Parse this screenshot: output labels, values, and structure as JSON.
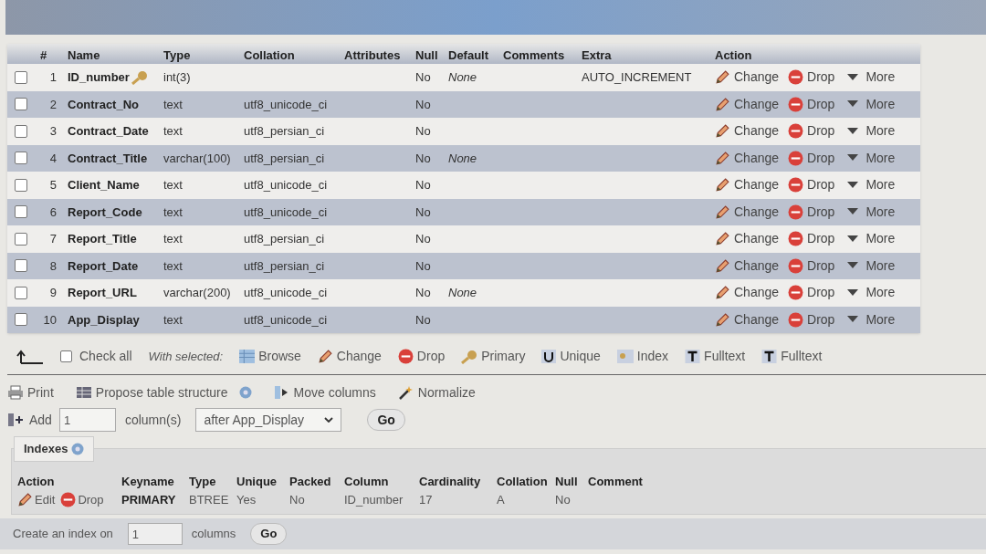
{
  "table": {
    "columns": [
      "#",
      "Name",
      "Type",
      "Collation",
      "Attributes",
      "Null",
      "Default",
      "Comments",
      "Extra",
      "Action"
    ],
    "rows": [
      {
        "number": "1",
        "name": "ID_number",
        "primary": true,
        "type": "int(3)",
        "collation": "",
        "null": "No",
        "default": "None",
        "extra": "AUTO_INCREMENT",
        "checked": false,
        "actions": [
          "Change",
          "Drop",
          "More"
        ]
      },
      {
        "number": "2",
        "name": "Contract_No",
        "primary": false,
        "type": "text",
        "collation": "utf8_unicode_ci",
        "null": "No",
        "default": "",
        "extra": "",
        "checked": false,
        "actions": [
          "Change",
          "Drop",
          "More"
        ]
      },
      {
        "number": "3",
        "name": "Contract_Date",
        "primary": false,
        "type": "text",
        "collation": "utf8_persian_ci",
        "null": "No",
        "default": "",
        "extra": "",
        "checked": false,
        "actions": [
          "Change",
          "Drop",
          "More"
        ]
      },
      {
        "number": "4",
        "name": "Contract_Title",
        "primary": false,
        "type": "varchar(100)",
        "collation": "utf8_persian_ci",
        "null": "No",
        "default": "None",
        "extra": "",
        "checked": false,
        "actions": [
          "Change",
          "Drop",
          "More"
        ]
      },
      {
        "number": "5",
        "name": "Client_Name",
        "primary": false,
        "type": "text",
        "collation": "utf8_unicode_ci",
        "null": "No",
        "default": "",
        "extra": "",
        "checked": false,
        "actions": [
          "Change",
          "Drop",
          "More"
        ]
      },
      {
        "number": "6",
        "name": "Report_Code",
        "primary": false,
        "type": "text",
        "collation": "utf8_unicode_ci",
        "null": "No",
        "default": "",
        "extra": "",
        "checked": false,
        "actions": [
          "Change",
          "Drop",
          "More"
        ]
      },
      {
        "number": "7",
        "name": "Report_Title",
        "primary": false,
        "type": "text",
        "collation": "utf8_persian_ci",
        "null": "No",
        "default": "",
        "extra": "",
        "checked": false,
        "actions": [
          "Change",
          "Drop",
          "More"
        ]
      },
      {
        "number": "8",
        "name": "Report_Date",
        "primary": false,
        "type": "text",
        "collation": "utf8_persian_ci",
        "null": "No",
        "default": "",
        "extra": "",
        "checked": false,
        "actions": [
          "Change",
          "Drop",
          "More"
        ]
      },
      {
        "number": "9",
        "name": "Report_URL",
        "primary": false,
        "type": "varchar(200)",
        "collation": "utf8_unicode_ci",
        "null": "No",
        "default": "None",
        "extra": "",
        "checked": false,
        "actions": [
          "Change",
          "Drop",
          "More"
        ]
      },
      {
        "number": "10",
        "name": "App_Display",
        "primary": false,
        "type": "text",
        "collation": "utf8_unicode_ci",
        "null": "No",
        "default": "",
        "extra": "",
        "checked": false,
        "actions": [
          "Change",
          "Drop",
          "More"
        ]
      }
    ]
  },
  "bulk": {
    "check_all": {
      "label": "Check all",
      "checked": false
    },
    "with_selected": "With selected:",
    "actions": [
      {
        "kind": "browse",
        "label": "Browse"
      },
      {
        "kind": "change",
        "label": "Change"
      },
      {
        "kind": "drop",
        "label": "Drop"
      },
      {
        "kind": "primary",
        "label": "Primary"
      },
      {
        "kind": "unique",
        "label": "Unique"
      },
      {
        "kind": "index",
        "label": "Index"
      },
      {
        "kind": "fulltext",
        "label": "Fulltext"
      },
      {
        "kind": "fulltext",
        "label": "Fulltext"
      }
    ]
  },
  "tools": [
    {
      "kind": "print",
      "label": "Print"
    },
    {
      "kind": "propose",
      "label": "Propose table structure"
    },
    {
      "kind": "move",
      "label": "Move columns"
    },
    {
      "kind": "normalize",
      "label": "Normalize"
    }
  ],
  "add_column": {
    "label": "Add",
    "count": "1",
    "unit": "column(s)",
    "position": "after App_Display",
    "button": "Go"
  },
  "indexes": {
    "title": "Indexes",
    "columns": [
      "Action",
      "Keyname",
      "Type",
      "Unique",
      "Packed",
      "Column",
      "Cardinality",
      "Collation",
      "Null",
      "Comment"
    ],
    "rows": [
      {
        "actions": [
          "Edit",
          "Drop"
        ],
        "keyname": "PRIMARY",
        "type": "BTREE",
        "unique": "Yes",
        "packed": "No",
        "column": "ID_number",
        "cardinality": "17",
        "collation": "A",
        "null": "No"
      }
    ]
  },
  "create_index": {
    "label": "Create an index on",
    "count": "1",
    "unit": "columns",
    "button": "Go"
  }
}
